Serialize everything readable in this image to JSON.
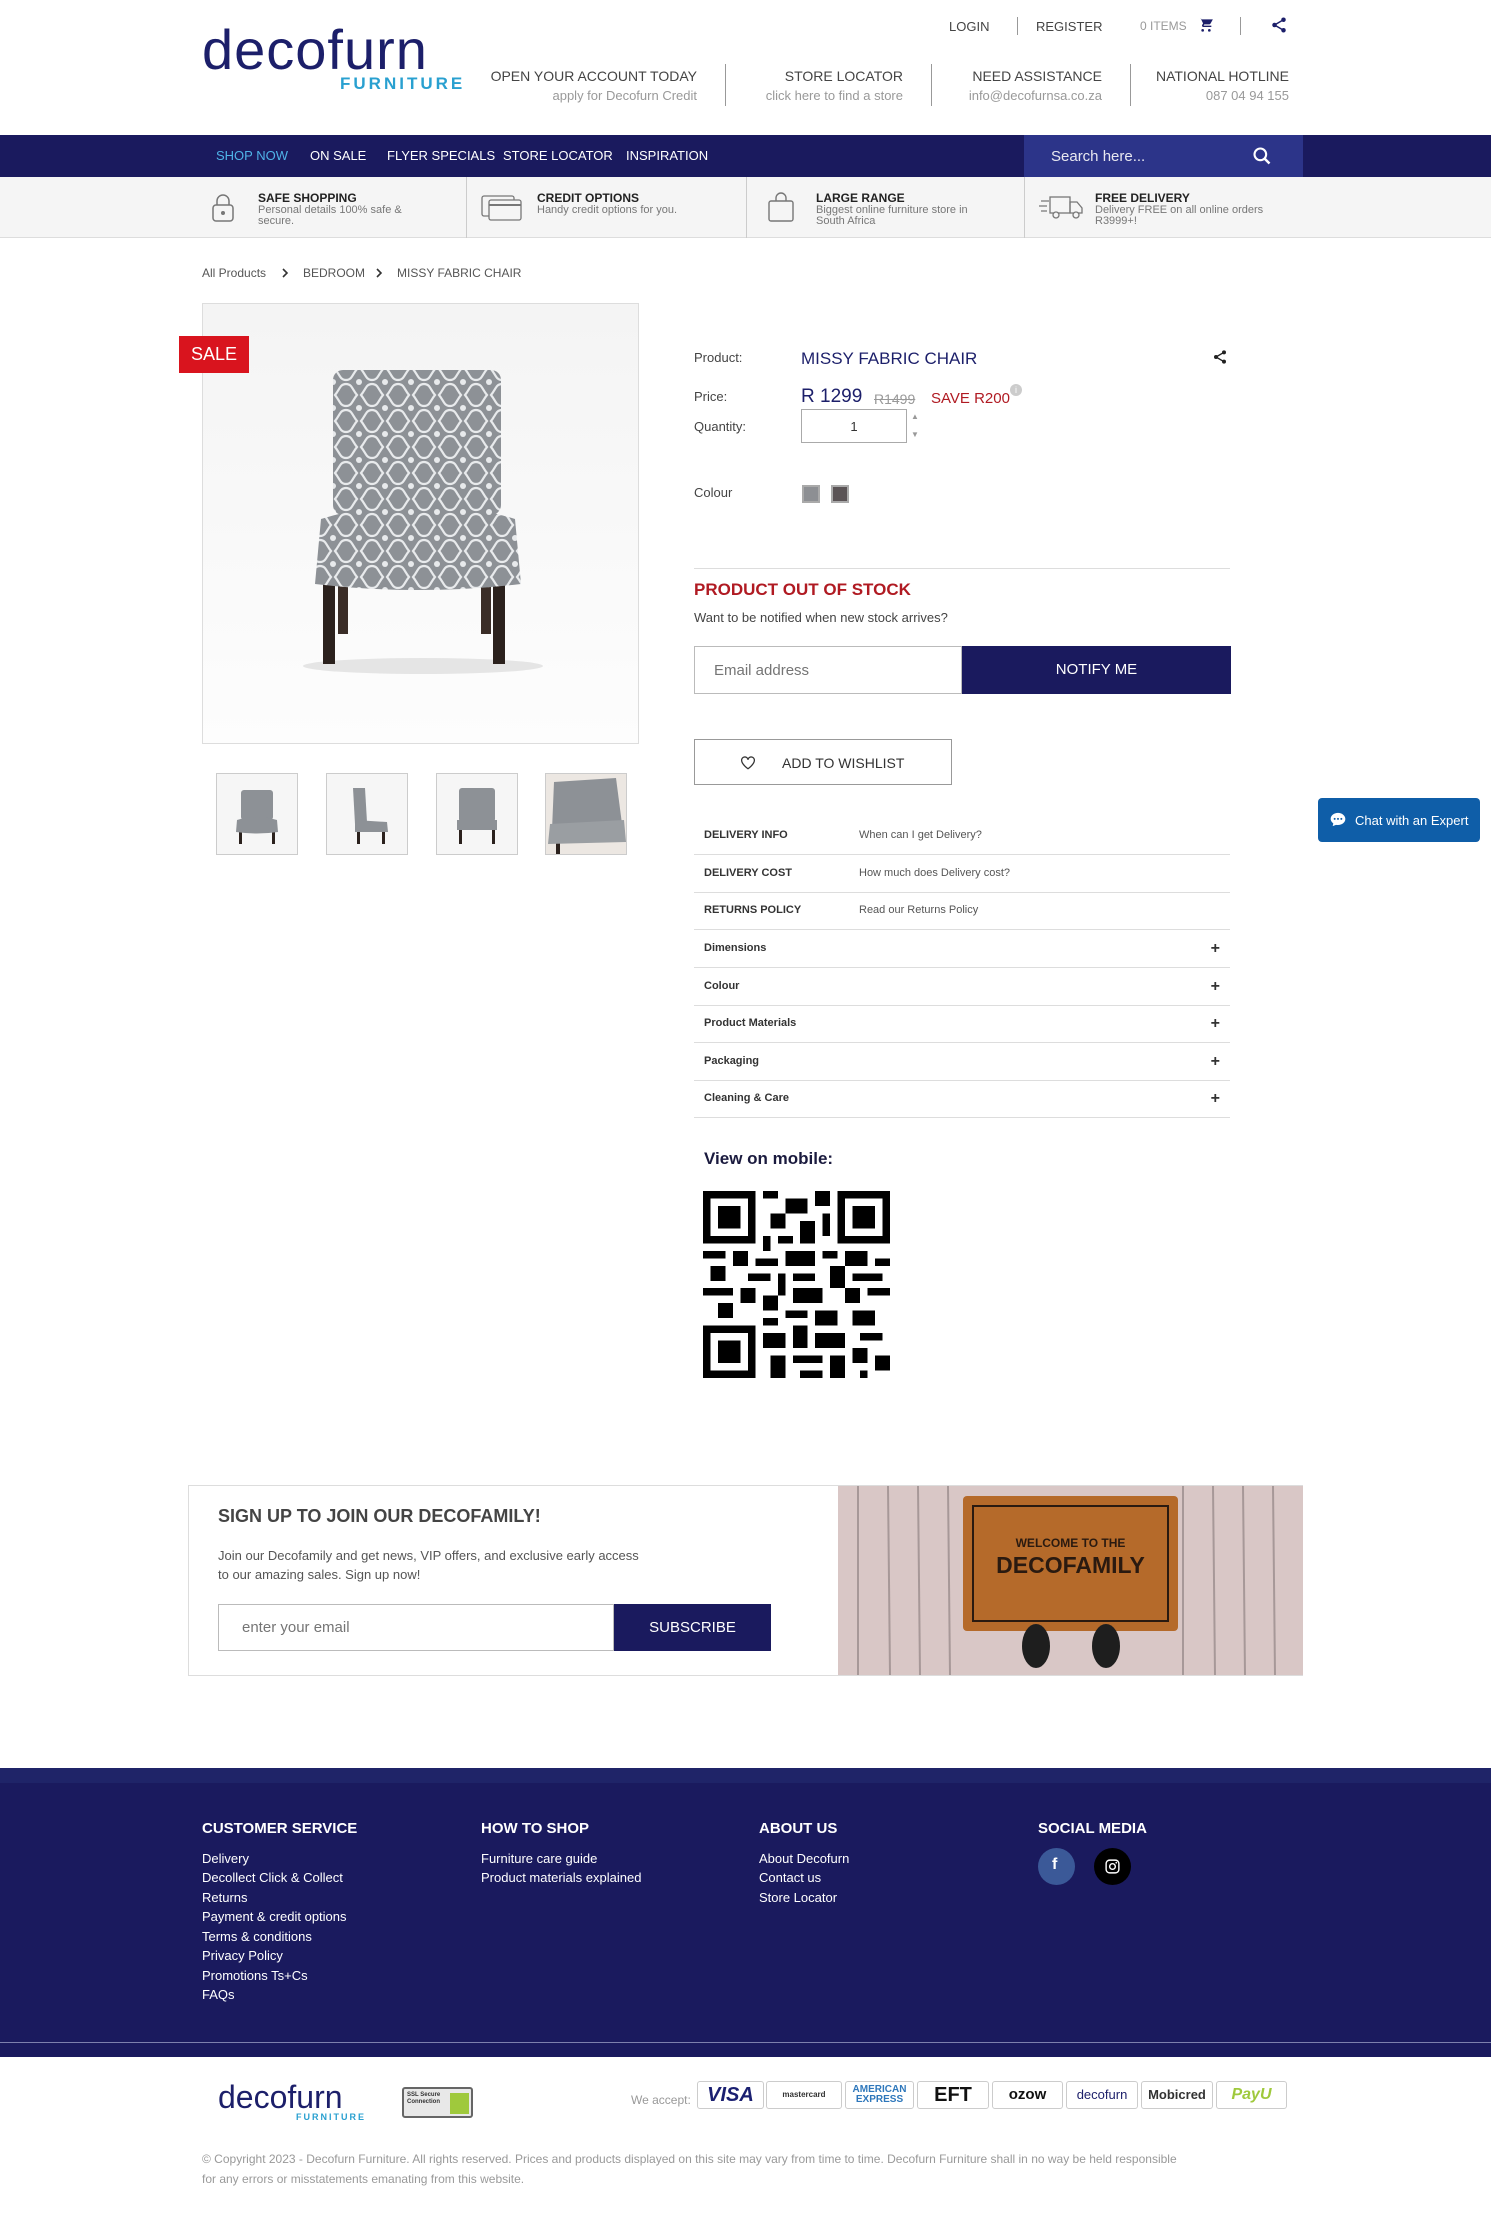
{
  "header": {
    "logo_main": "decofurn",
    "logo_sub": "FURNITURE",
    "login": "LOGIN",
    "register": "REGISTER",
    "cart_count": "0 ITEMS",
    "info": [
      {
        "title": "OPEN YOUR ACCOUNT TODAY",
        "sub": "apply for Decofurn Credit"
      },
      {
        "title": "STORE LOCATOR",
        "sub": "click here to find a store"
      },
      {
        "title": "NEED ASSISTANCE",
        "sub": "info@decofurnsa.co.za"
      },
      {
        "title": "NATIONAL HOTLINE",
        "sub": "087 04 94 155"
      }
    ]
  },
  "nav": {
    "items": [
      "SHOP NOW",
      "ON SALE",
      "FLYER SPECIALS",
      "STORE LOCATOR",
      "INSPIRATION"
    ],
    "search_placeholder": "Search here..."
  },
  "features": [
    {
      "title": "SAFE SHOPPING",
      "desc": "Personal details 100% safe & secure."
    },
    {
      "title": "CREDIT OPTIONS",
      "desc": "Handy credit options for you."
    },
    {
      "title": "LARGE RANGE",
      "desc": "Biggest online furniture store in South Africa"
    },
    {
      "title": "FREE DELIVERY",
      "desc": "Delivery FREE on all online orders R3999+!"
    }
  ],
  "breadcrumb": [
    "All Products",
    "BEDROOM",
    "MISSY FABRIC CHAIR"
  ],
  "product": {
    "sale_badge": "SALE",
    "product_label": "Product:",
    "name": "MISSY FABRIC CHAIR",
    "price_label": "Price:",
    "price": "R 1299",
    "old_price": "R1499",
    "save": "SAVE R200",
    "quantity_label": "Quantity:",
    "quantity": "1",
    "colour_label": "Colour",
    "colours": [
      "#8d8f93",
      "#5b5456"
    ],
    "out_of_stock": "PRODUCT OUT OF STOCK",
    "notify_text": "Want to be notified when new stock arrives?",
    "email_placeholder": "Email address",
    "notify_button": "NOTIFY ME",
    "wishlist": "ADD TO WISHLIST"
  },
  "info_rows": [
    {
      "key": "DELIVERY INFO",
      "value": "When can I get Delivery?"
    },
    {
      "key": "DELIVERY COST",
      "value": "How much does Delivery cost?"
    },
    {
      "key": "RETURNS POLICY",
      "value": "Read our Returns Policy"
    }
  ],
  "accordion": [
    "Dimensions",
    "Colour",
    "Product Materials",
    "Packaging",
    "Cleaning & Care"
  ],
  "accordion_plus": "+",
  "mobile_label": "View on mobile:",
  "chat_label": "Chat with an Expert",
  "signup": {
    "title": "SIGN UP TO JOIN OUR DECOFAMILY!",
    "text1": "Join our Decofamily and get news, VIP offers, and exclusive early access",
    "text2": "to our amazing sales. Sign up now!",
    "placeholder": "enter your email",
    "button": "SUBSCRIBE",
    "mat_line1": "WELCOME TO THE",
    "mat_line2": "DECOFAMILY"
  },
  "footer": {
    "columns": [
      {
        "heading": "CUSTOMER SERVICE",
        "links": [
          "Delivery",
          "Decollect Click & Collect",
          "Returns",
          "Payment & credit options",
          "Terms & conditions",
          "Privacy Policy",
          "Promotions Ts+Cs",
          "FAQs"
        ]
      },
      {
        "heading": "HOW TO SHOP",
        "links": [
          "Furniture care guide",
          "Product materials explained"
        ]
      },
      {
        "heading": "ABOUT US",
        "links": [
          "About Decofurn",
          "Contact us",
          "Store Locator"
        ]
      },
      {
        "heading": "SOCIAL MEDIA",
        "links": []
      }
    ],
    "social_colors": {
      "facebook": "#3b5998",
      "instagram": "#000000"
    }
  },
  "bottom": {
    "ssl_text": "SSL Secure Connection",
    "we_accept": "We accept:",
    "payments": [
      "VISA",
      "mastercard",
      "AMERICAN EXPRESS",
      "EFT",
      "ozow",
      "decofurn",
      "Mobicred",
      "PayU"
    ],
    "copyright1": "© Copyright 2023 - Decofurn Furniture. All rights reserved. Prices and products displayed on this site may vary from time to time. Decofurn Furniture shall in no way be held responsible",
    "copyright2": "for any errors or misstatements emanating from this website."
  }
}
